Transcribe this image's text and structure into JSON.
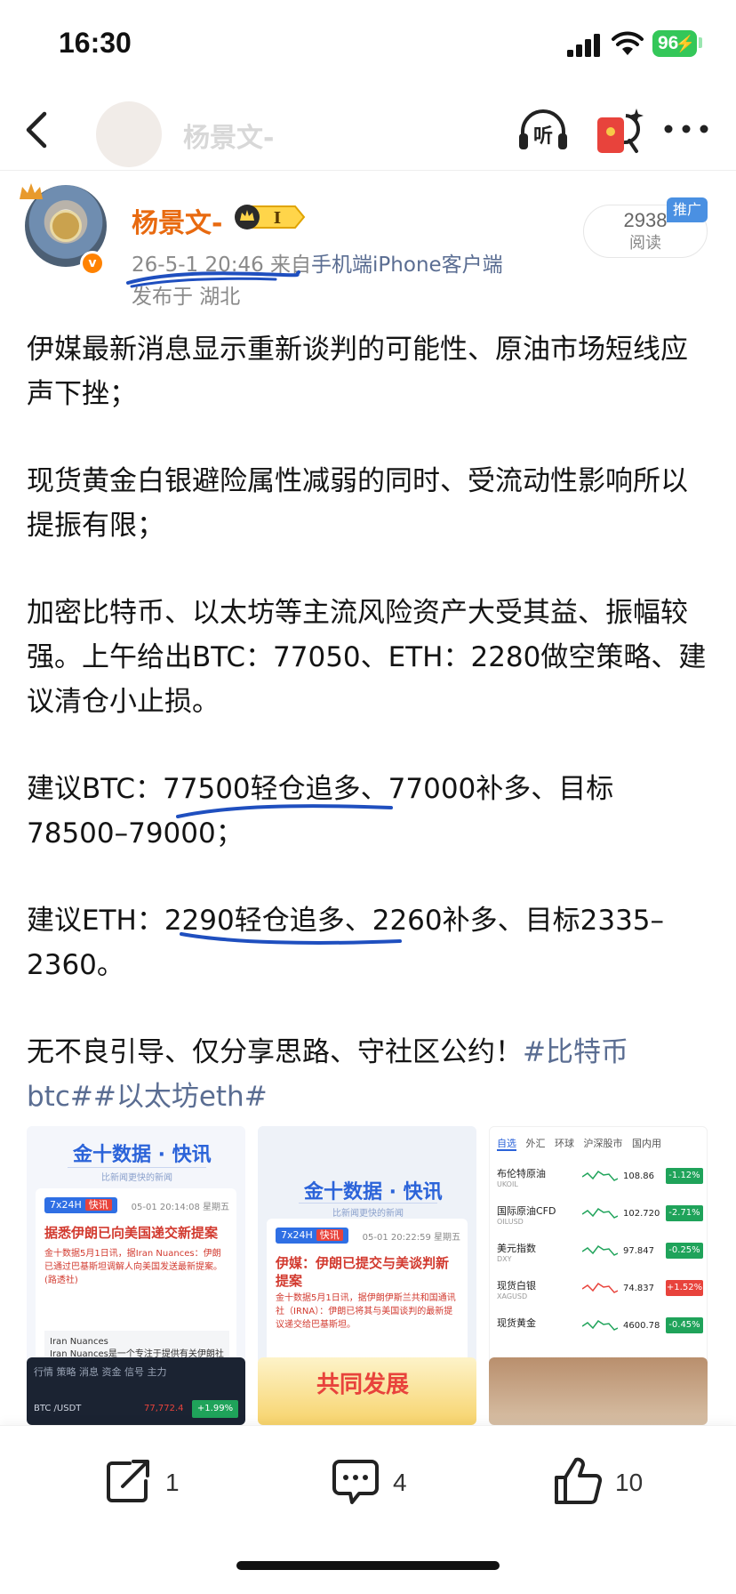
{
  "status_bar": {
    "time": "16:30",
    "battery": "96"
  },
  "nav": {
    "title": "杨景文-"
  },
  "author": {
    "name": "杨景文-",
    "vip_level": "I",
    "timestamp": "26-5-1 20:46",
    "source_prefix": "来自",
    "source": "手机端iPhone客户端",
    "location": "发布于 湖北",
    "read_count": "2938",
    "read_label": "阅读",
    "promo": "推广"
  },
  "post": {
    "p1": "伊媒最新消息显示重新谈判的可能性、原油市场短线应声下挫；",
    "p2": "现货黄金白银避险属性减弱的同时、受流动性影响所以提振有限；",
    "p3": "加密比特币、以太坊等主流风险资产大受其益、振幅较强。上午给出BTC：77050、ETH：2280做空策略、建议清仓小止损。",
    "p4": "建议BTC：77500轻仓追多、77000补多、目标78500–79000；",
    "p5": "建议ETH：2290轻仓追多、2260补多、目标2335–2360。",
    "p6_text": "无不良引导、仅分享思路、守社区公约！",
    "p6_tags": "#比特币btc##以太坊eth#"
  },
  "images": {
    "img1": {
      "logo": "金十数据 · 快讯",
      "slogan": "比新闻更快的新闻",
      "chip": "7x24H",
      "chip_tag": "快讯",
      "time": "05-01 20:14:08 星期五",
      "headline": "据悉伊朗已向美国递交新提案",
      "snippet": "金十数据5月1日讯，据Iran Nuances：伊朗已通过巴基斯坦调解人向美国发送最新提案。(路透社)",
      "box_title": "Iran Nuances",
      "box_text": "Iran Nuances是一个专注于提供有关伊朗社"
    },
    "img2": {
      "logo": "金十数据 · 快讯",
      "slogan": "比新闻更快的新闻",
      "chip": "7x24H",
      "chip_tag": "快讯",
      "time": "05-01 20:22:59 星期五",
      "headline": "伊媒：伊朗已提交与美谈判新提案",
      "snippet": "金十数据5月1日讯，据伊朗伊斯兰共和国通讯社（IRNA）：伊朗已将其与美国谈判的最新提议递交给巴基斯坦。"
    },
    "img3": {
      "tabs": [
        "自选",
        "外汇",
        "环球",
        "沪深股市",
        "国内用"
      ],
      "rows": [
        {
          "name": "布伦特原油",
          "code": "UKOIL",
          "price": "108.86",
          "change": "-1.12%",
          "color": "#1fa35a"
        },
        {
          "name": "国际原油CFD",
          "code": "OILUSD",
          "price": "102.720",
          "change": "-2.71%",
          "color": "#1fa35a"
        },
        {
          "name": "美元指数",
          "code": "DXY",
          "price": "97.847",
          "change": "-0.25%",
          "color": "#1fa35a"
        },
        {
          "name": "现货白银",
          "code": "XAGUSD",
          "price": "74.837",
          "change": "+1.52%",
          "color": "#e8433c"
        },
        {
          "name": "现货黄金",
          "code": "",
          "price": "4600.78",
          "change": "-0.45%",
          "color": "#1fa35a"
        }
      ]
    },
    "img4": {
      "tabs": "行情  策略  消息  资金  信号  主力",
      "symbol": "BTC /USDT",
      "price": "77,772.4",
      "change": "+1.99%"
    },
    "img5": {
      "text": "共同发展"
    }
  },
  "actions": {
    "share_count": "1",
    "comment_count": "4",
    "like_count": "10"
  },
  "colors": {
    "accent_orange": "#e86a10",
    "link_blue": "#5a6d92",
    "ink_blue": "#1f4fbf",
    "vip_green": "#34c759"
  }
}
